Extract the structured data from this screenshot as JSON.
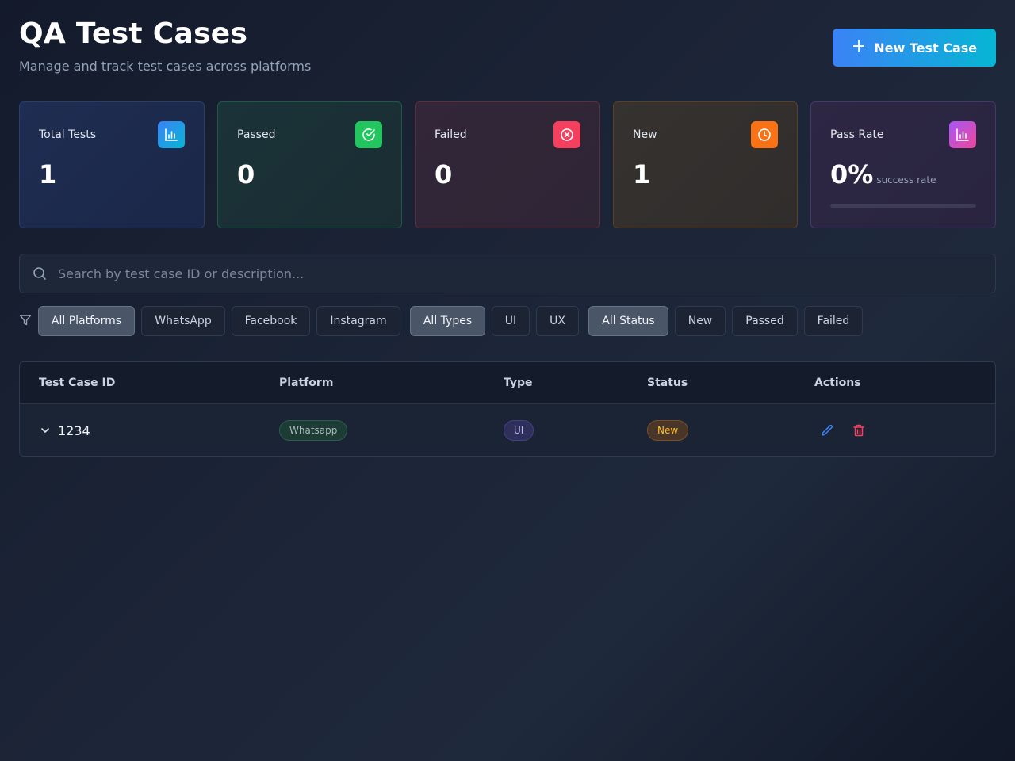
{
  "header": {
    "title": "QA Test Cases",
    "subtitle": "Manage and track test cases across platforms",
    "new_button_label": "New Test Case"
  },
  "stats": {
    "total": {
      "label": "Total Tests",
      "value": "1",
      "icon": "bar-chart-icon"
    },
    "passed": {
      "label": "Passed",
      "value": "0",
      "icon": "check-circle-icon"
    },
    "failed": {
      "label": "Failed",
      "value": "0",
      "icon": "x-circle-icon"
    },
    "new": {
      "label": "New",
      "value": "1",
      "icon": "clock-icon"
    },
    "pass_rate": {
      "label": "Pass Rate",
      "value": "0%",
      "sub": "success rate",
      "icon": "bar-chart-icon",
      "progress": 0
    }
  },
  "search": {
    "placeholder": "Search by test case ID or description...",
    "value": ""
  },
  "filters": {
    "platforms": [
      "All Platforms",
      "WhatsApp",
      "Facebook",
      "Instagram"
    ],
    "types": [
      "All Types",
      "UI",
      "UX"
    ],
    "statuses": [
      "All Status",
      "New",
      "Passed",
      "Failed"
    ],
    "selected": {
      "platform": "All Platforms",
      "type": "All Types",
      "status": "All Status"
    }
  },
  "table": {
    "columns": [
      "Test Case ID",
      "Platform",
      "Type",
      "Status",
      "Actions"
    ],
    "rows": [
      {
        "id": "1234",
        "platform": "Whatsapp",
        "type": "UI",
        "status": "New"
      }
    ]
  },
  "colors": {
    "accent_gradient": [
      "#3b82f6",
      "#06b6d4"
    ],
    "passed": "#22c55e",
    "failed": "#f43f5e",
    "new": "#f97316",
    "pass_rate": "#a855f7"
  }
}
